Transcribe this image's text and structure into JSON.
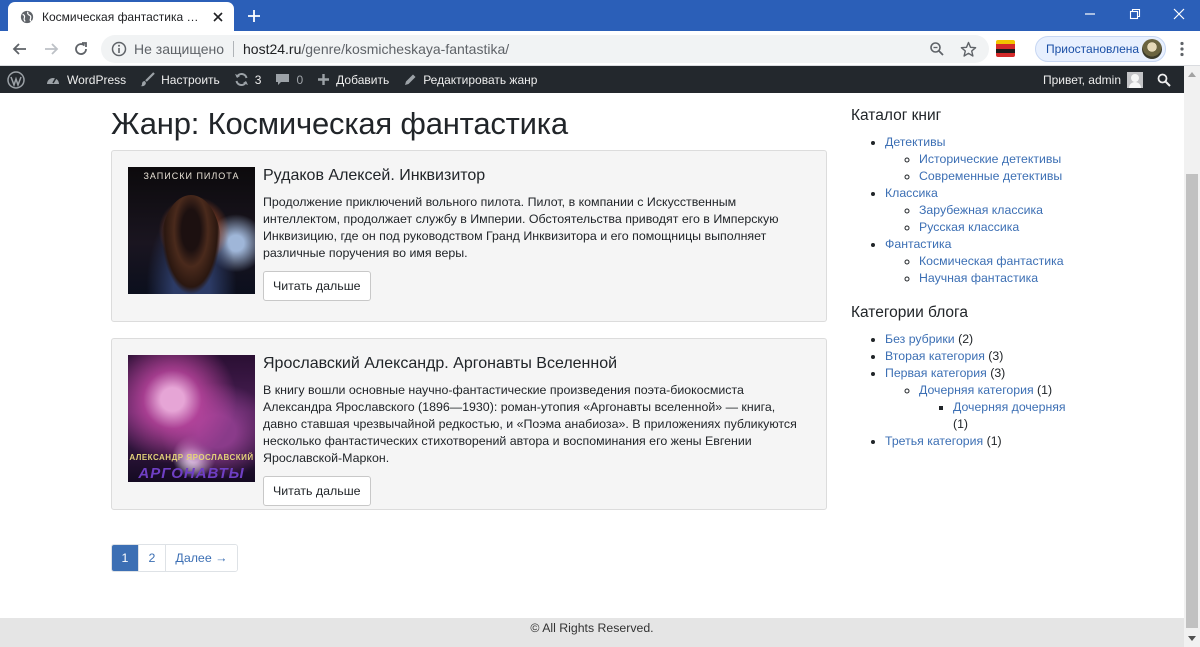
{
  "browser": {
    "tab_title": "Космическая фантастика — Wo",
    "security_label": "Не защищено",
    "url_host": "host24.ru",
    "url_path": "/genre/kosmicheskaya-fantastika/",
    "profile_label": "Приостановлена"
  },
  "adminbar": {
    "site": "WordPress",
    "customize": "Настроить",
    "updates_count": "3",
    "comments_count": "0",
    "add_new": "Добавить",
    "edit_genre": "Редактировать жанр",
    "greeting": "Привет, admin"
  },
  "page": {
    "title": "Жанр: Космическая фантастика"
  },
  "posts": [
    {
      "cover_text": "ЗАПИСКИ ПИЛОТА",
      "title": "Рудаков Алексей. Инквизитор",
      "excerpt": "Продолжение приключений вольного пилота. Пилот, в компании с Искусственным интеллектом, продолжает службу в Империи. Обстоятельства приводят его в Имперскую Инквизицию, где он под руководством Гранд Инквизитора и его помощницы выполняет различные поручения во имя веры.",
      "read_more": "Читать дальше"
    },
    {
      "cover_text": "АЛЕКСАНДР ЯРОСЛАВСКИЙ",
      "cover_text2": "АРГОНАВТЫ",
      "title": "Ярославский Александр. Аргонавты Вселенной",
      "excerpt": "В книгу вошли основные научно-фантастические произведения поэта-биокосмиста Александра Ярославского (1896—1930): роман-утопия «Аргонавты вселенной» — книга, давно ставшая чрезвычайной редкостью, и «Поэма анабиоза». В приложениях публикуются несколько фантастических стихотворений автора и воспоминания его жены Евгении Ярославской-Маркон.",
      "read_more": "Читать дальше"
    }
  ],
  "pagination": {
    "page1": "1",
    "page2": "2",
    "next": "Далее →"
  },
  "sidebar": {
    "catalog_title": "Каталог книг",
    "catalog": {
      "detectives": "Детективы",
      "historical_detectives": "Исторические детективы",
      "modern_detectives": "Современные детективы",
      "classics": "Классика",
      "foreign_classics": "Зарубежная классика",
      "russian_classics": "Русская классика",
      "fantasy": "Фантастика",
      "space_fiction": "Космическая фантастика",
      "science_fiction": "Научная фантастика"
    },
    "categories_title": "Категории блога",
    "categories": {
      "uncategorized": "Без рубрики",
      "uncategorized_count": "(2)",
      "second": "Вторая категория",
      "second_count": "(3)",
      "first": "Первая категория",
      "first_count": "(3)",
      "child": "Дочерняя категория",
      "child_count": "(1)",
      "grandchild": "Дочерняя дочерняя",
      "grandchild_count": "(1)",
      "third": "Третья категория",
      "third_count": "(1)"
    }
  },
  "footer": {
    "text": "© All Rights Reserved."
  },
  "colors": {
    "chrome_tabstrip": "#2b5fb8",
    "adminbar_bg": "#23282d",
    "link": "#3c6fb4",
    "card_bg": "#f5f5f5",
    "footer_bg": "#e5e5e5"
  },
  "icons": {
    "favicon": "globe-icon",
    "tab_close": "close-icon",
    "new_tab": "plus-icon",
    "back": "arrow-left-icon",
    "forward": "arrow-right-icon",
    "reload": "reload-icon",
    "info": "info-icon",
    "zoom": "zoom-icon",
    "bookmark": "star-icon",
    "extension": "extension-icon",
    "menu": "kebab-menu-icon",
    "wp_logo": "wordpress-logo-icon",
    "customize": "brush-icon",
    "updates": "update-icon",
    "comments": "comment-icon",
    "add": "plus-icon",
    "edit": "pencil-icon",
    "search": "search-icon",
    "user": "user-avatar-icon"
  }
}
